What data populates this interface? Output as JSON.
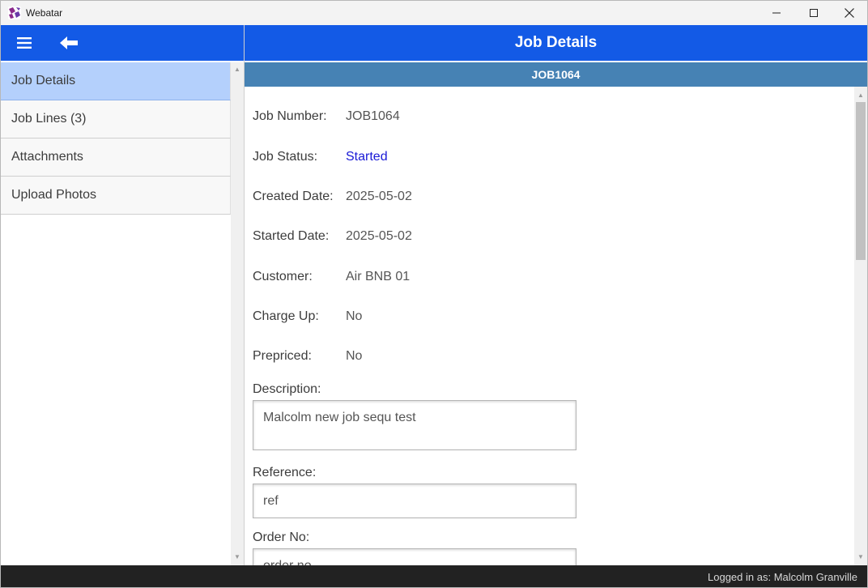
{
  "window": {
    "title": "Webatar",
    "logo_colors": [
      "#8b2a8b",
      "#6a3aa8"
    ]
  },
  "header": {
    "title": "Job Details",
    "job_id": "JOB1064",
    "accent": "#135ae6",
    "sub_accent": "#4682b4"
  },
  "sidebar": {
    "items": [
      {
        "label": "Job Details",
        "active": true
      },
      {
        "label": "Job Lines (3)",
        "active": false
      },
      {
        "label": "Attachments",
        "active": false
      },
      {
        "label": "Upload Photos",
        "active": false
      }
    ]
  },
  "details": {
    "job_number": {
      "label": "Job Number:",
      "value": "JOB1064"
    },
    "job_status": {
      "label": "Job Status:",
      "value": "Started"
    },
    "created_date": {
      "label": "Created Date:",
      "value": "2025-05-02"
    },
    "started_date": {
      "label": "Started Date:",
      "value": "2025-05-02"
    },
    "customer": {
      "label": "Customer:",
      "value": "Air BNB 01"
    },
    "charge_up": {
      "label": "Charge Up:",
      "value": "No"
    },
    "prepriced": {
      "label": "Prepriced:",
      "value": "No"
    }
  },
  "form": {
    "description": {
      "label": "Description:",
      "value": "Malcolm new job sequ test"
    },
    "reference": {
      "label": "Reference:",
      "value": "ref"
    },
    "order_no": {
      "label": "Order No:",
      "value": "order no"
    }
  },
  "icons": {
    "menu": "hamburger-icon",
    "back": "arrow-left-icon",
    "minimize": "minimize-icon",
    "maximize": "maximize-icon",
    "close": "close-icon"
  },
  "status": {
    "logged_in": "Logged in as: Malcolm Granville"
  }
}
